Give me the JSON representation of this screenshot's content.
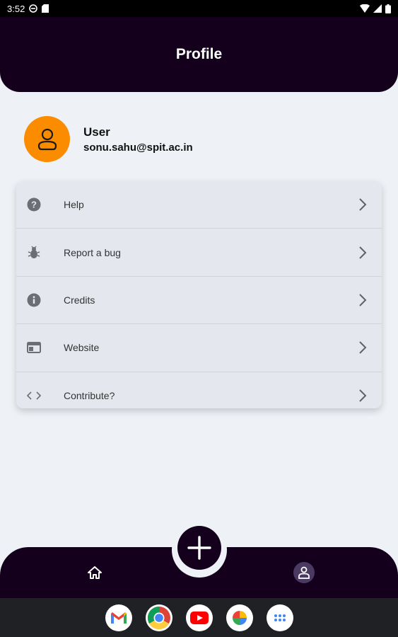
{
  "status_bar": {
    "time": "3:52"
  },
  "header": {
    "title": "Profile"
  },
  "profile": {
    "name": "User",
    "email": "sonu.sahu@spit.ac.in"
  },
  "menu": [
    {
      "label": "Help",
      "icon": "help-icon"
    },
    {
      "label": "Report a bug",
      "icon": "bug-icon"
    },
    {
      "label": "Credits",
      "icon": "info-icon"
    },
    {
      "label": "Website",
      "icon": "web-icon"
    },
    {
      "label": "Contribute?",
      "icon": "code-icon"
    }
  ],
  "colors": {
    "header_bg": "#14001c",
    "avatar_bg": "#fb8c00",
    "card_bg": "#e4e8ee",
    "page_bg": "#eef2f6"
  },
  "dock": [
    "gmail-icon",
    "chrome-icon",
    "youtube-icon",
    "photos-icon",
    "apps-icon"
  ]
}
